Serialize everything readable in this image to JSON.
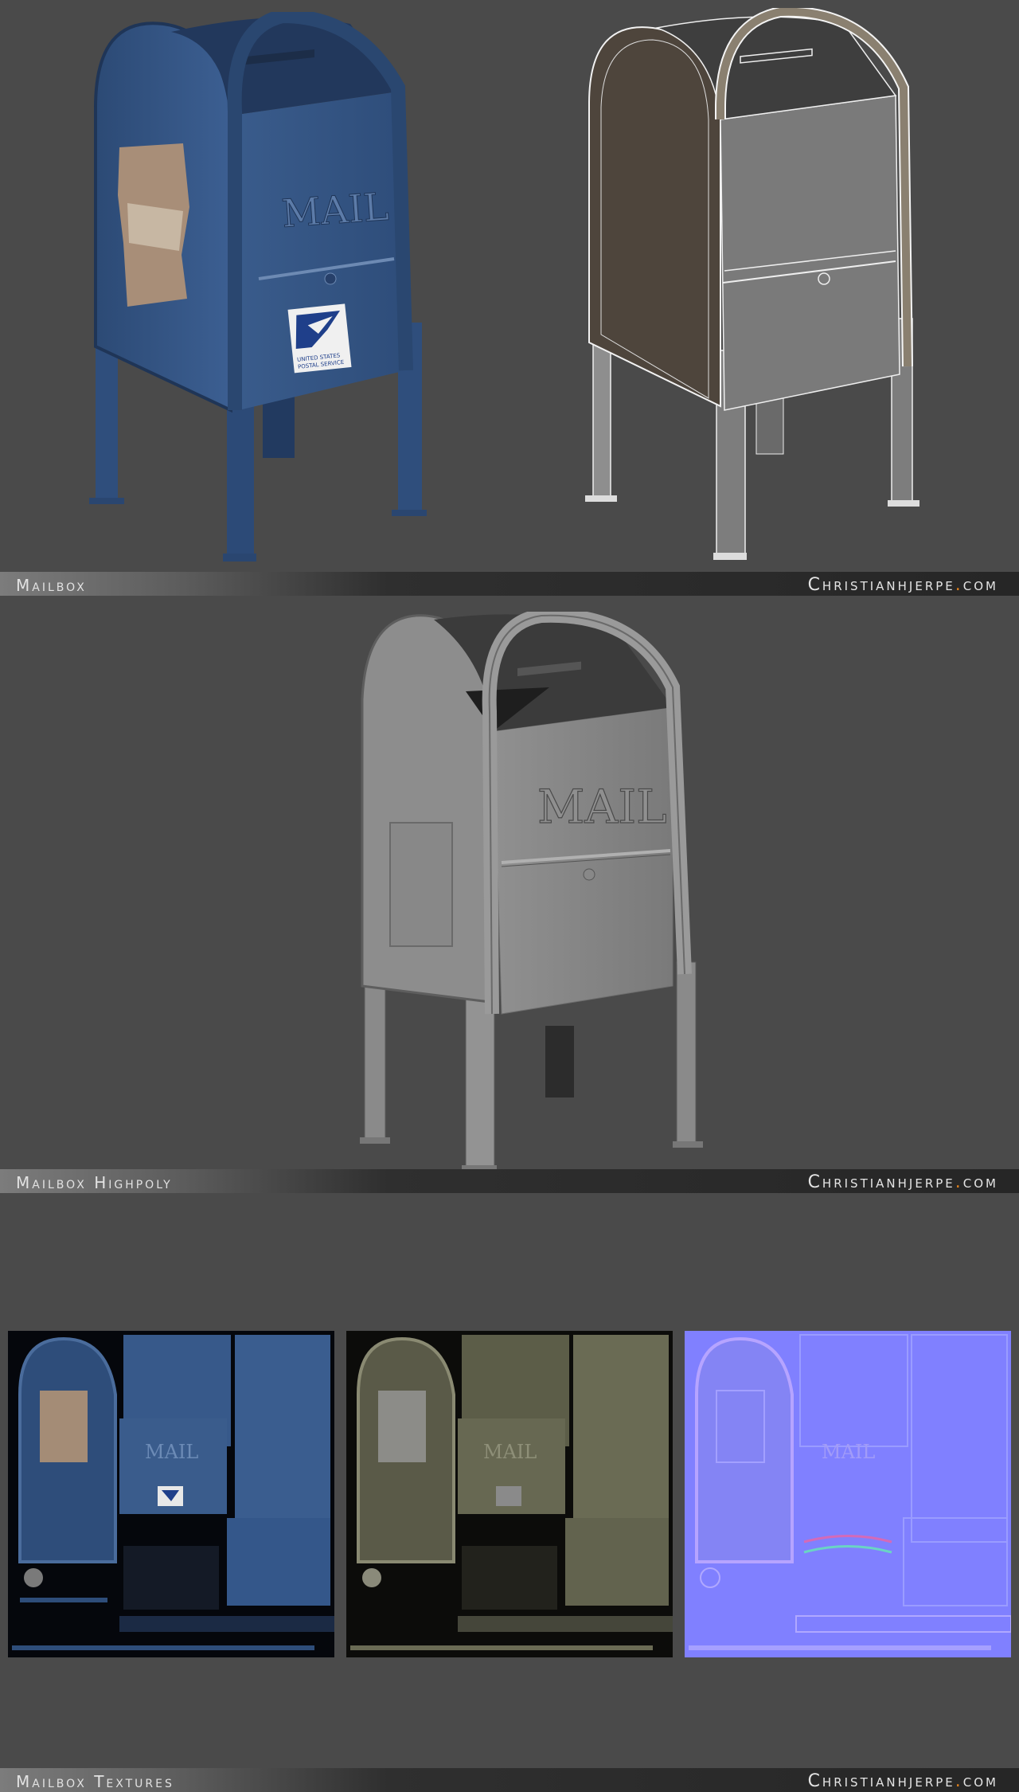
{
  "sections": [
    {
      "title": "Mailbox",
      "site_main": "Christianhjerpe",
      "site_dot": ".",
      "site_tld": "com"
    },
    {
      "title": "Mailbox Highpoly",
      "site_main": "Christianhjerpe",
      "site_dot": ".",
      "site_tld": "com"
    },
    {
      "title": "Mailbox Textures",
      "site_main": "Christianhjerpe",
      "site_dot": ".",
      "site_tld": "com"
    }
  ],
  "labels": {
    "mail_text": "MAIL",
    "usps_line1": "UNITED STATES",
    "usps_line2": "POSTAL SERVICE"
  },
  "colors": {
    "background": "#4a4a4a",
    "mailbox_blue": "#35578a",
    "highpoly_gray": "#8a8a8a",
    "normal_map": "#8080ff",
    "accent_dot": "#e0801c"
  }
}
